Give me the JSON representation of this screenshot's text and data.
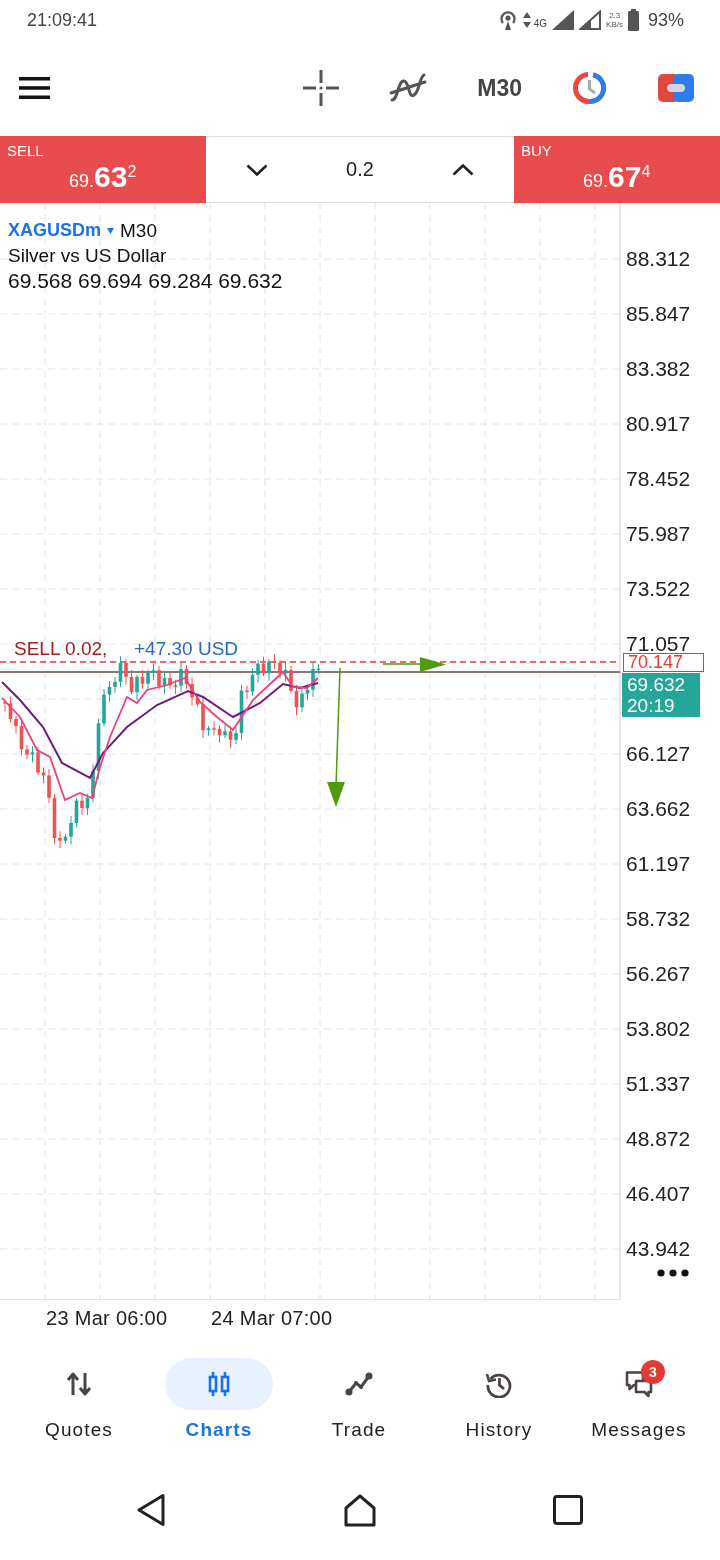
{
  "status_bar": {
    "time": "21:09:41",
    "network_type": "4G",
    "data_speed": "2.3",
    "data_speed_unit": "KB/s",
    "battery": "93%"
  },
  "toolbar": {
    "timeframe": "M30"
  },
  "trade_panel": {
    "sell": {
      "label": "SELL",
      "price": "69.**63**$^{2}$"
    },
    "volume": "0.2",
    "buy": {
      "label": "BUY",
      "price": "69.**67**$^{4}$"
    }
  },
  "chart": {
    "symbol": "XAGUSDm",
    "timeframe": "M30",
    "description": "Silver vs US Dollar",
    "ohlc": "69.568 69.694 69.284 69.632",
    "position_label": "SELL 0.02,",
    "position_profit": "+47.30 USD",
    "order_price": "70.147",
    "bid_price": "69.632",
    "bar_countdown": "20:19",
    "price_axis": [
      "88.312",
      "85.847",
      "83.382",
      "80.917",
      "78.452",
      "75.987",
      "73.522",
      "71.057",
      "66.127",
      "63.662",
      "61.197",
      "58.732",
      "56.267",
      "53.802",
      "51.337",
      "48.872",
      "46.407",
      "43.942"
    ],
    "time_axis": [
      "23 Mar 06:00",
      "24 Mar 07:00"
    ]
  },
  "bottom_nav": [
    {
      "label": "Quotes",
      "selected": false
    },
    {
      "label": "Charts",
      "selected": true
    },
    {
      "label": "Trade",
      "selected": false
    },
    {
      "label": "History",
      "selected": false
    },
    {
      "label": "Messages",
      "selected": false,
      "badge": "3"
    }
  ]
}
